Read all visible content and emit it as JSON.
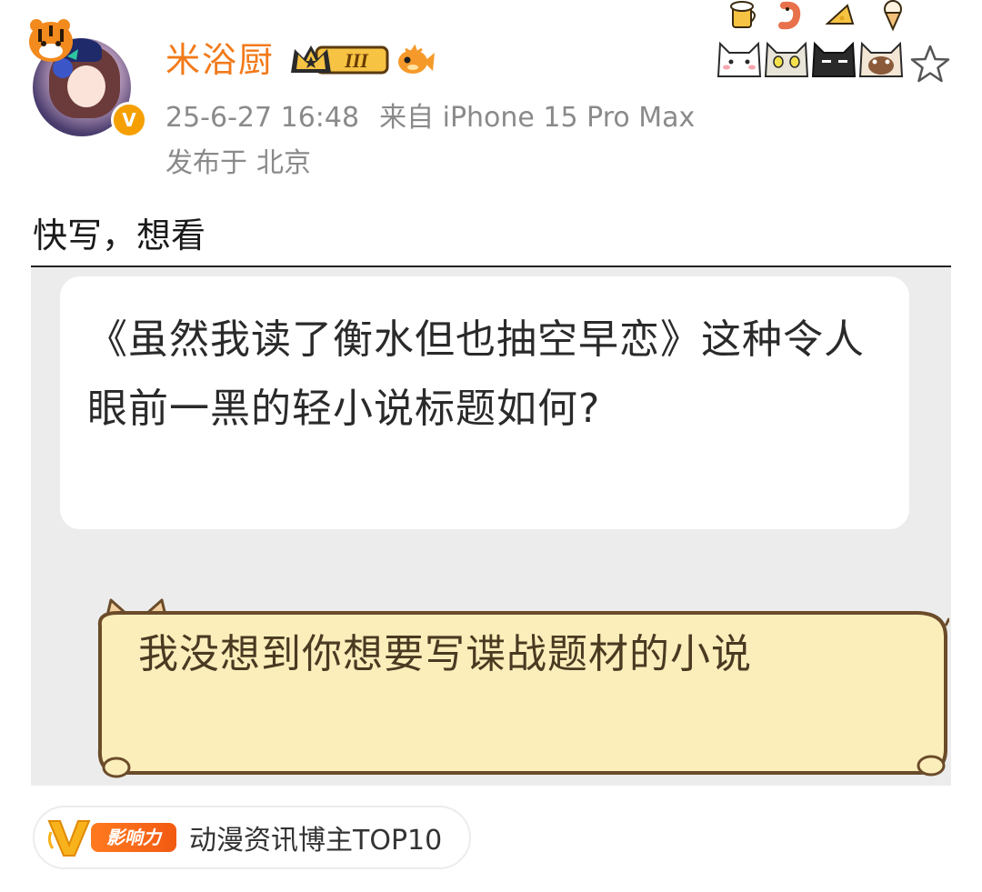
{
  "author": {
    "name": "米浴厨",
    "vip_level": "III",
    "verified_mark": "V",
    "avatar_icon": "avatar-image",
    "tiger_icon": "tiger-pendant-icon",
    "fish_icon": "fish-badge-icon"
  },
  "meta": {
    "datetime": "25-6-27 16:48",
    "source": "来自 iPhone 15 Pro Max",
    "location_prefix": "发布于",
    "location": "北京"
  },
  "post": {
    "text": "快写，想看"
  },
  "image": {
    "question": "《虽然我读了衡水但也抽空早恋》这种令人眼前一黑的轻小说标题如何?",
    "answer": "我没想到你想要写谍战题材的小说"
  },
  "influence": {
    "logo_letter": "V",
    "label": "影响力",
    "text": "动漫资讯博主TOP10"
  },
  "decorations": {
    "icons": [
      "beer-icon",
      "shrimp-icon",
      "cheese-icon",
      "ice-cream-icon",
      "white-cat-icon",
      "gray-cat-icon",
      "black-cat-icon",
      "siamese-cat-icon"
    ],
    "star_icon": "favorite-star-icon"
  },
  "colors": {
    "username": "#f27a1a",
    "meta": "#8a8a8a",
    "verified": "#f5a000",
    "scroll": "#fbeebb",
    "scroll_border": "#6b4b2a"
  }
}
